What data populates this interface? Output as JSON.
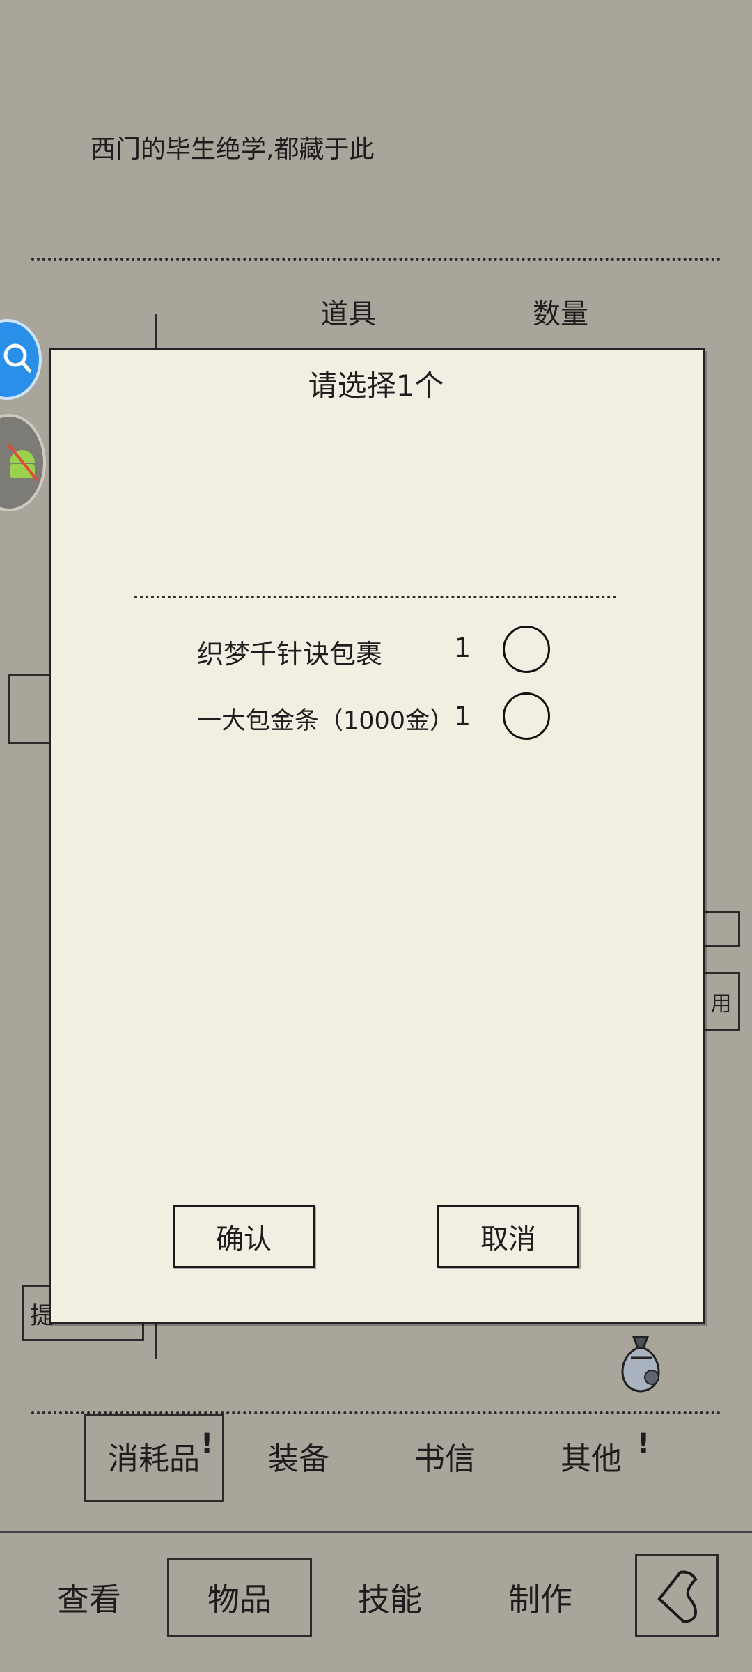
{
  "background": {
    "quote": "西门的毕生绝学,都藏于此",
    "columns": {
      "item": "道具",
      "quantity": "数量"
    },
    "side_button_fragment": "用",
    "bottom_left_fragment": "提"
  },
  "dialog": {
    "title": "请选择1个",
    "options": [
      {
        "name": "织梦千针诀包裹",
        "quantity": "1",
        "selected": false
      },
      {
        "name": "一大包金条（1000金）",
        "quantity": "1",
        "selected": false
      }
    ],
    "confirm_label": "确认",
    "cancel_label": "取消"
  },
  "category_tabs": [
    {
      "label": "消耗品",
      "active": true,
      "has_alert": true
    },
    {
      "label": "装备",
      "active": false,
      "has_alert": false
    },
    {
      "label": "书信",
      "active": false,
      "has_alert": false
    },
    {
      "label": "其他",
      "active": false,
      "has_alert": true
    }
  ],
  "bottom_nav": [
    {
      "label": "查看",
      "active": false
    },
    {
      "label": "物品",
      "active": true
    },
    {
      "label": "技能",
      "active": false
    },
    {
      "label": "制作",
      "active": false
    }
  ],
  "icons": {
    "back": "back-arrow-icon",
    "bag": "money-bag-icon",
    "search": "search-icon",
    "debug": "android-icon"
  },
  "colors": {
    "page_bg": "#aaa59b",
    "dialog_bg": "#f2eee2",
    "ink": "#1e1e1e",
    "float_blue": "#2a8fe8"
  }
}
